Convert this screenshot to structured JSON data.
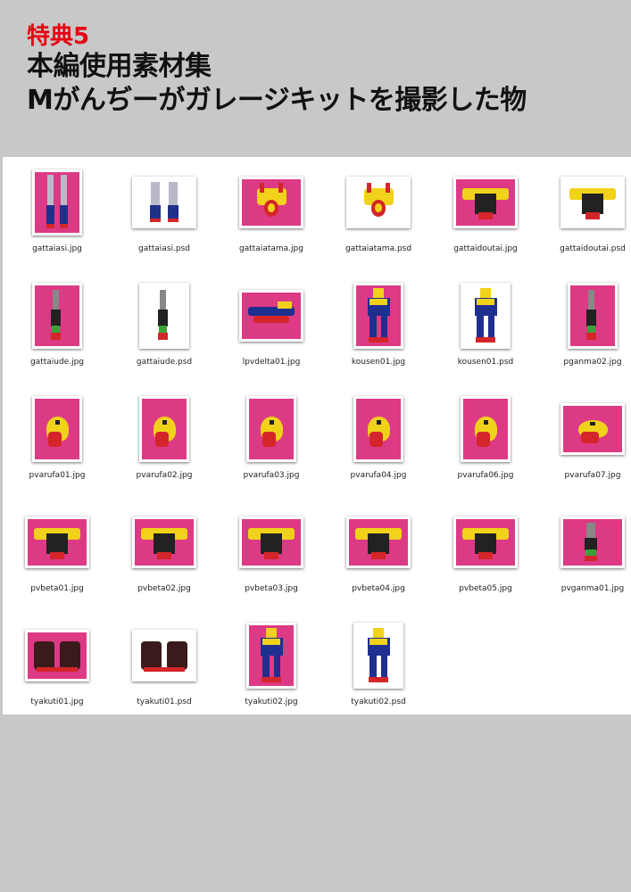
{
  "header": {
    "badge": "特典5",
    "line1": "本編使用素材集",
    "line2": "Mがんぢーがガレージキットを撮影した物"
  },
  "colors": {
    "badge": "#e60012",
    "magenta_background": "#dd3a85",
    "white_background": "#ffffff",
    "page_background": "#c8c8c8"
  },
  "files": [
    {
      "name": "gattaiasi.jpg",
      "bg": "magenta",
      "orient": "tall",
      "icon": "legs-icon"
    },
    {
      "name": "gattaiasi.psd",
      "bg": "white",
      "orient": "wide",
      "icon": "legs-icon"
    },
    {
      "name": "gattaiatama.jpg",
      "bg": "magenta",
      "orient": "wide",
      "icon": "head-icon"
    },
    {
      "name": "gattaiatama.psd",
      "bg": "white",
      "orient": "wide",
      "icon": "head-icon"
    },
    {
      "name": "gattaidoutai.jpg",
      "bg": "magenta",
      "orient": "wide",
      "icon": "torso-icon"
    },
    {
      "name": "gattaidoutai.psd",
      "bg": "white",
      "orient": "wide",
      "icon": "torso-icon"
    },
    {
      "name": "gattaiude.jpg",
      "bg": "magenta",
      "orient": "tall",
      "icon": "arm-icon"
    },
    {
      "name": "gattaiude.psd",
      "bg": "white",
      "orient": "tall",
      "icon": "arm-icon"
    },
    {
      "name": "lpvdelta01.jpg",
      "bg": "magenta",
      "orient": "wide",
      "icon": "jet-icon"
    },
    {
      "name": "kousen01.jpg",
      "bg": "magenta",
      "orient": "tall",
      "icon": "robot-icon"
    },
    {
      "name": "kousen01.psd",
      "bg": "white",
      "orient": "tall",
      "icon": "robot-icon"
    },
    {
      "name": "pganma02.jpg",
      "bg": "magenta",
      "orient": "tall",
      "icon": "arm-icon"
    },
    {
      "name": "pvarufa01.jpg",
      "bg": "magenta",
      "orient": "tall",
      "icon": "bird-icon"
    },
    {
      "name": "pvarufa02.jpg",
      "bg": "magenta",
      "orient": "tall",
      "icon": "bird-icon"
    },
    {
      "name": "pvarufa03.jpg",
      "bg": "magenta",
      "orient": "tall",
      "icon": "bird-icon"
    },
    {
      "name": "pvarufa04.jpg",
      "bg": "magenta",
      "orient": "tall",
      "icon": "bird-icon"
    },
    {
      "name": "pvarufa06.jpg",
      "bg": "magenta",
      "orient": "tall",
      "icon": "bird-icon"
    },
    {
      "name": "pvarufa07.jpg",
      "bg": "magenta",
      "orient": "wide",
      "icon": "bird-icon"
    },
    {
      "name": "pvbeta01.jpg",
      "bg": "magenta",
      "orient": "wide",
      "icon": "torso-icon"
    },
    {
      "name": "pvbeta02.jpg",
      "bg": "magenta",
      "orient": "wide",
      "icon": "torso-icon"
    },
    {
      "name": "pvbeta03.jpg",
      "bg": "magenta",
      "orient": "wide",
      "icon": "torso-icon"
    },
    {
      "name": "pvbeta04.jpg",
      "bg": "magenta",
      "orient": "wide",
      "icon": "torso-icon"
    },
    {
      "name": "pvbeta05.jpg",
      "bg": "magenta",
      "orient": "wide",
      "icon": "torso-icon"
    },
    {
      "name": "pvganma01.jpg",
      "bg": "magenta",
      "orient": "wide",
      "icon": "arm-icon"
    },
    {
      "name": "tyakuti01.jpg",
      "bg": "magenta",
      "orient": "wide",
      "icon": "feet-icon"
    },
    {
      "name": "tyakuti01.psd",
      "bg": "white",
      "orient": "wide",
      "icon": "feet-icon"
    },
    {
      "name": "tyakuti02.jpg",
      "bg": "magenta",
      "orient": "tall",
      "icon": "robot-icon"
    },
    {
      "name": "tyakuti02.psd",
      "bg": "white",
      "orient": "tall",
      "icon": "robot-icon"
    }
  ]
}
